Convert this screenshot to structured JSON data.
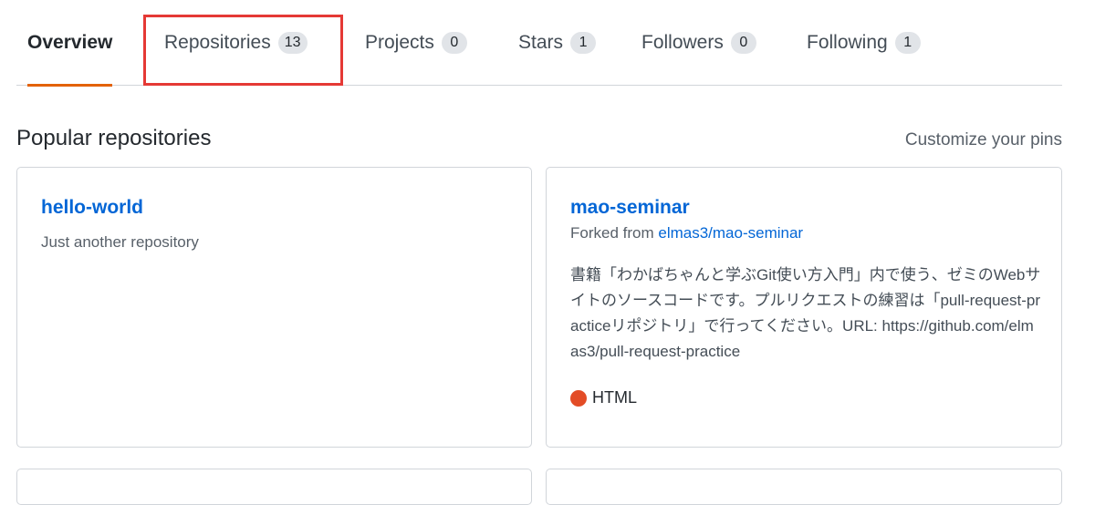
{
  "tabs": [
    {
      "label": "Overview",
      "count": ""
    },
    {
      "label": "Repositories",
      "count": "13"
    },
    {
      "label": "Projects",
      "count": "0"
    },
    {
      "label": "Stars",
      "count": "1"
    },
    {
      "label": "Followers",
      "count": "0"
    },
    {
      "label": "Following",
      "count": "1"
    }
  ],
  "colors": {
    "accent": "#e36209",
    "highlight": "#e53935",
    "link": "#0366d6",
    "html_language": "#e34c26"
  },
  "popular": {
    "title": "Popular repositories",
    "customize_label": "Customize your pins",
    "repos": [
      {
        "name": "hello-world",
        "description": "Just another repository"
      },
      {
        "name": "mao-seminar",
        "forked_prefix": "Forked from",
        "forked_from": "elmas3/mao-seminar",
        "description": "書籍「わかばちゃんと学ぶGit使い方入門」内で使う、ゼミのWebサイトのソースコードです。プルリクエストの練習は「pull-request-practiceリポジトリ」で行ってください。URL: https://github.com/elmas3/pull-request-practice",
        "language": "HTML"
      }
    ]
  }
}
